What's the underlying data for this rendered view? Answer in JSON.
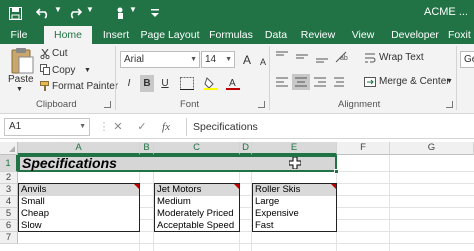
{
  "window": {
    "title": "ACME ..."
  },
  "ribbon_tabs": [
    "File",
    "Home",
    "Insert",
    "Page Layout",
    "Formulas",
    "Data",
    "Review",
    "View",
    "Developer",
    "Foxit"
  ],
  "clipboard": {
    "paste": "Paste",
    "cut": "Cut",
    "copy": "Copy",
    "format_painter": "Format Painter",
    "label": "Clipboard"
  },
  "font": {
    "name": "Arial",
    "size": "14",
    "label": "Font",
    "bold": "B",
    "italic": "I",
    "underline": "U"
  },
  "alignment": {
    "wrap_text": "Wrap Text",
    "merge_center": "Merge & Center",
    "label": "Alignment"
  },
  "number": {
    "format": "Ge"
  },
  "formula_bar": {
    "name_box": "A1",
    "fx": "fx",
    "content": "Specifications"
  },
  "columns": [
    "A",
    "B",
    "C",
    "D",
    "E",
    "F",
    "G"
  ],
  "rows": [
    "1",
    "2",
    "3",
    "4",
    "5",
    "6",
    "7"
  ],
  "sheet": {
    "a1": "Specifications",
    "tables": [
      {
        "header": "Anvils",
        "items": [
          "Small",
          "Cheap",
          "Slow"
        ]
      },
      {
        "header": "Jet Motors",
        "items": [
          "Medium",
          "Moderately Priced",
          "Acceptable Speed"
        ]
      },
      {
        "header": "Roller Skis",
        "items": [
          "Large",
          "Expensive",
          "Fast"
        ]
      }
    ]
  },
  "colors": {
    "accent": "#217346",
    "selection": "#d6d6d6",
    "header_fill": "#d9d9d9",
    "comment_marker": "#c00000"
  }
}
